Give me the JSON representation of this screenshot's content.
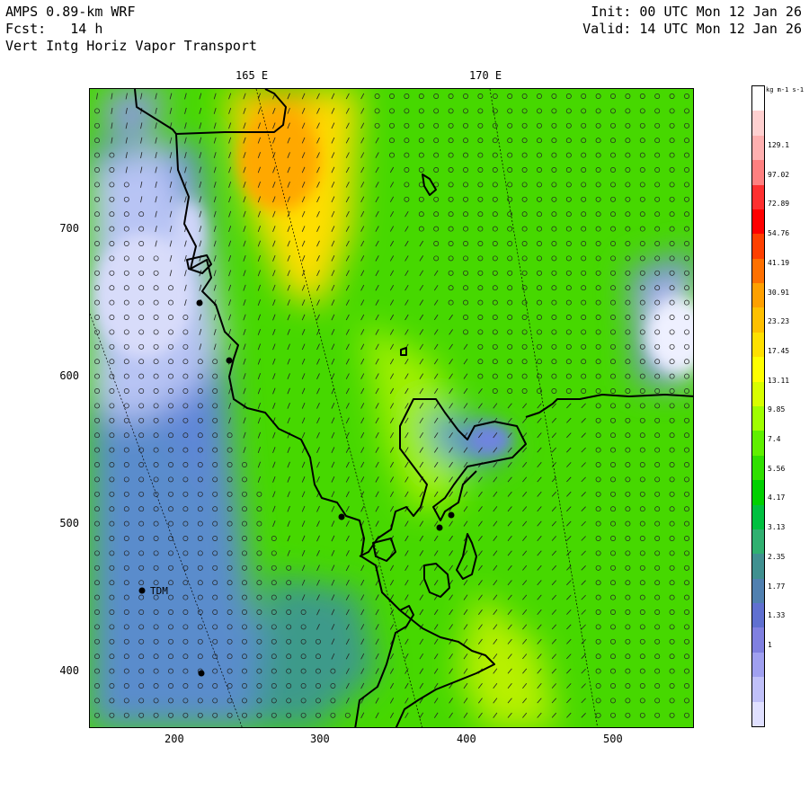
{
  "header": {
    "model": "AMPS 0.89-km WRF",
    "forecast": "Fcst:   14 h",
    "field": "Vert Intg Horiz Vapor Transport",
    "init": "Init: 00 UTC Mon 12 Jan 26",
    "valid": "Valid: 14 UTC Mon 12 Jan 26"
  },
  "longitude_labels": [
    "165 E",
    "170 E"
  ],
  "axes": {
    "x_ticks": [
      "200",
      "300",
      "400",
      "500"
    ],
    "y_ticks": [
      "700",
      "600",
      "500",
      "400"
    ]
  },
  "colorbar": {
    "unit": "kg m-1 s-1",
    "levels": [
      "129.1",
      "97.02",
      "72.89",
      "54.76",
      "41.19",
      "30.91",
      "23.23",
      "17.45",
      "13.11",
      "9.85",
      "7.4",
      "5.56",
      "4.17",
      "3.13",
      "2.35",
      "1.77",
      "1.33",
      "1"
    ],
    "colors": [
      "#ffffff",
      "#ffd0d0",
      "#ffb0b0",
      "#ff8080",
      "#ff3030",
      "#ff0000",
      "#ff4000",
      "#ff7000",
      "#ffa000",
      "#ffc000",
      "#ffe000",
      "#ffff00",
      "#d8ff00",
      "#a0ff00",
      "#60f000",
      "#30e000",
      "#00d000",
      "#00c040",
      "#30b070",
      "#409090",
      "#5080b0",
      "#6070d0",
      "#8080e0",
      "#a0a0f0",
      "#c0c0f8",
      "#e0e0ff"
    ]
  },
  "stations": [
    {
      "name": "TDM"
    }
  ],
  "colors": {
    "land_low": "#7f86e0",
    "transport_green": "#42e000",
    "transport_yellow": "#ffe000",
    "coastline": "#000000"
  }
}
